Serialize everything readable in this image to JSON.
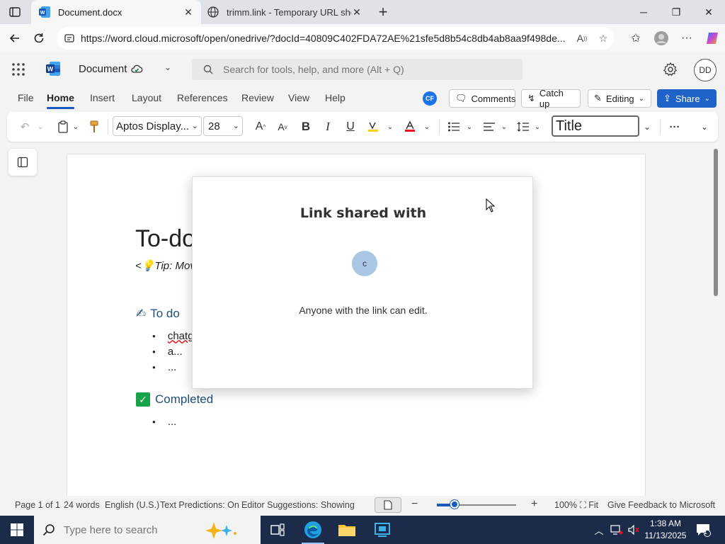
{
  "browser": {
    "tabs": [
      {
        "title": "Document.docx",
        "active": true
      },
      {
        "title": "trimm.link - Temporary URL short",
        "active": false
      }
    ],
    "url": "https://word.cloud.microsoft/open/onedrive/?docId=40809C402FDA72AE%21sfe5d8b54c8db4ab8aa9f498de..."
  },
  "word": {
    "doc_name": "Document",
    "search_placeholder": "Search for tools, help, and more (Alt + Q)",
    "user_initials": "DD",
    "ribbon_tabs": [
      "File",
      "Home",
      "Insert",
      "Layout",
      "References",
      "Review",
      "View",
      "Help"
    ],
    "active_tab": "Home",
    "collab_initials": "CF",
    "comments_label": "Comments",
    "catchup_label": "Catch up",
    "editing_label": "Editing",
    "share_label": "Share",
    "font_name": "Aptos Display...",
    "font_size": "28",
    "style_name": "Title"
  },
  "document": {
    "title_fragment": "To-do",
    "tip_fragment": "<💡Tip: Mov",
    "section_todo": "To do",
    "todo_items": [
      "chatg",
      "a...",
      "..."
    ],
    "section_done": "Completed",
    "done_items": [
      "..."
    ]
  },
  "dialog": {
    "title": "Link shared with",
    "recipient_initial": "c",
    "permission_text": "Anyone with the link can edit."
  },
  "status": {
    "page": "Page 1 of 1",
    "words": "24 words",
    "language": "English (U.S.)",
    "text_predictions": "Text Predictions: On",
    "editor": "Editor Suggestions: Showing",
    "zoom": "100%",
    "zoom_fraction": 0.22,
    "fit": "Fit",
    "feedback": "Give Feedback to Microsoft"
  },
  "taskbar": {
    "search_placeholder": "Type here to search",
    "time": "1:38 AM",
    "date": "11/13/2025",
    "notification_count": "1"
  },
  "colors": {
    "accent": "#185abd",
    "share": "#1f62c8",
    "taskbar": "#1c2b4a",
    "heading": "#1f4e79"
  }
}
